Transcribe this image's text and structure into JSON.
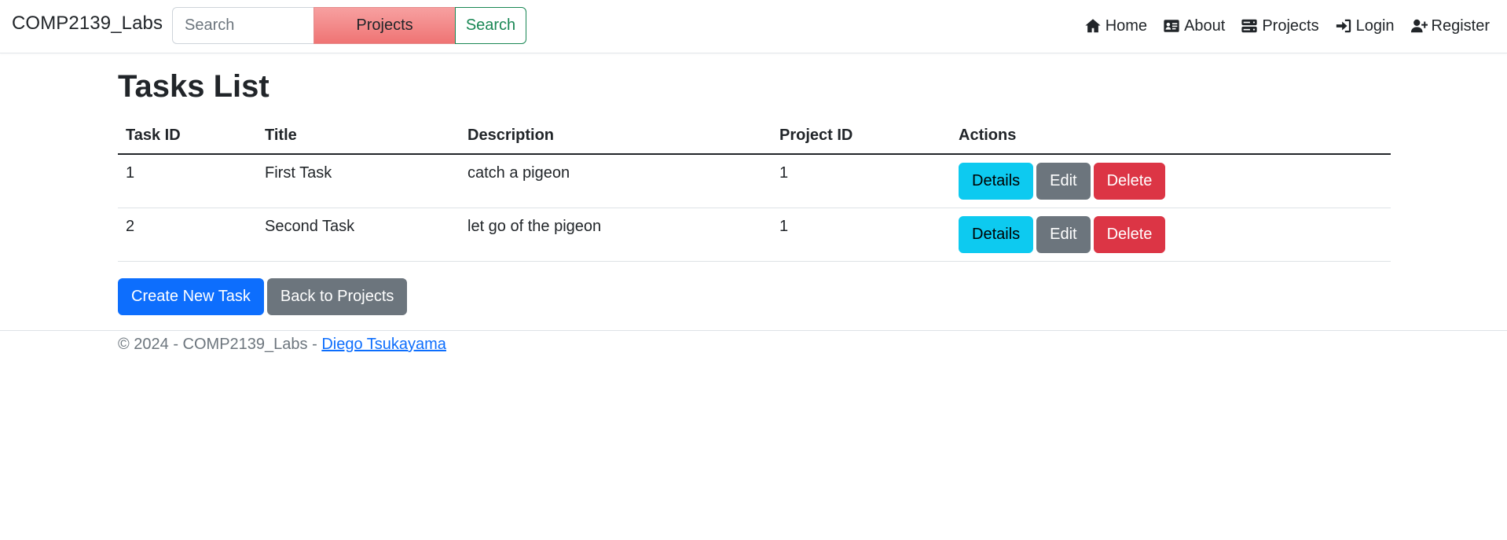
{
  "navbar": {
    "brand": "COMP2139_Labs",
    "search_placeholder": "Search",
    "category_selected": "Projects",
    "search_button": "Search",
    "links": [
      {
        "label": "Home",
        "icon": "home-icon"
      },
      {
        "label": "About",
        "icon": "id-card-icon"
      },
      {
        "label": "Projects",
        "icon": "server-icon"
      },
      {
        "label": "Login",
        "icon": "sign-in-icon"
      },
      {
        "label": "Register",
        "icon": "user-plus-icon"
      }
    ]
  },
  "main": {
    "title": "Tasks List",
    "table": {
      "headers": [
        "Task ID",
        "Title",
        "Description",
        "Project ID",
        "Actions"
      ],
      "rows": [
        {
          "id": "1",
          "title": "First Task",
          "description": "catch a pigeon",
          "project_id": "1"
        },
        {
          "id": "2",
          "title": "Second Task",
          "description": "let go of the pigeon",
          "project_id": "1"
        }
      ],
      "actions": {
        "details": "Details",
        "edit": "Edit",
        "delete": "Delete"
      }
    },
    "create_button": "Create New Task",
    "back_button": "Back to Projects"
  },
  "footer": {
    "text": "© 2024 - COMP2139_Labs - ",
    "author_link": "Diego Tsukayama"
  },
  "colors": {
    "primary": "#0d6efd",
    "info": "#0dcaf0",
    "secondary": "#6c757d",
    "danger": "#dc3545",
    "success": "#198754",
    "projects_select": "#f28b8b"
  }
}
